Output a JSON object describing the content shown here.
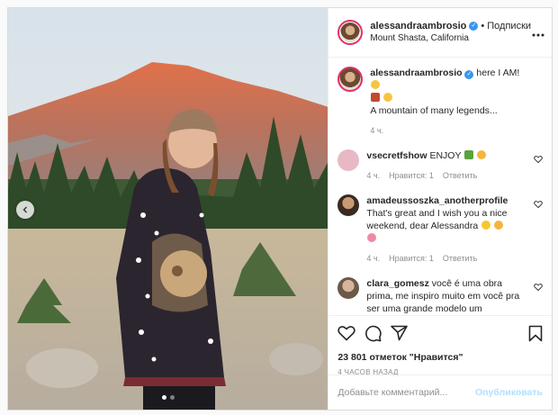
{
  "header": {
    "username": "alessandraambrosio",
    "separator": "•",
    "follow_label": "Подписки",
    "location": "Mount Shasta, California",
    "more_label": "•••"
  },
  "comments": [
    {
      "username": "alessandraambrosio",
      "text": "here I AM!",
      "text2": "A mountain of many legends...",
      "time": "4 ч."
    },
    {
      "username": "vsecretfshow",
      "text": "ENJOY",
      "time": "4 ч.",
      "likes": "Нравится: 1",
      "reply": "Ответить"
    },
    {
      "username": "amadeussoszka_anotherprofile",
      "text": "That's great and I wish you a nice weekend, dear Alessandra",
      "time": "4 ч.",
      "likes": "Нравится: 1",
      "reply": "Ответить"
    },
    {
      "username": "clara_gomesz",
      "text": "você é uma obra prima, me inspiro muito em você pra ser uma grande modelo um"
    }
  ],
  "likes_count": "23 801 отметок \"Нравится\"",
  "timestamp": "4 ЧАСОВ НАЗАД",
  "comment_input": {
    "placeholder": "Добавьте комментарий..."
  },
  "post_label": "Опубликовать",
  "carousel": {
    "total": 2,
    "active": 1
  }
}
